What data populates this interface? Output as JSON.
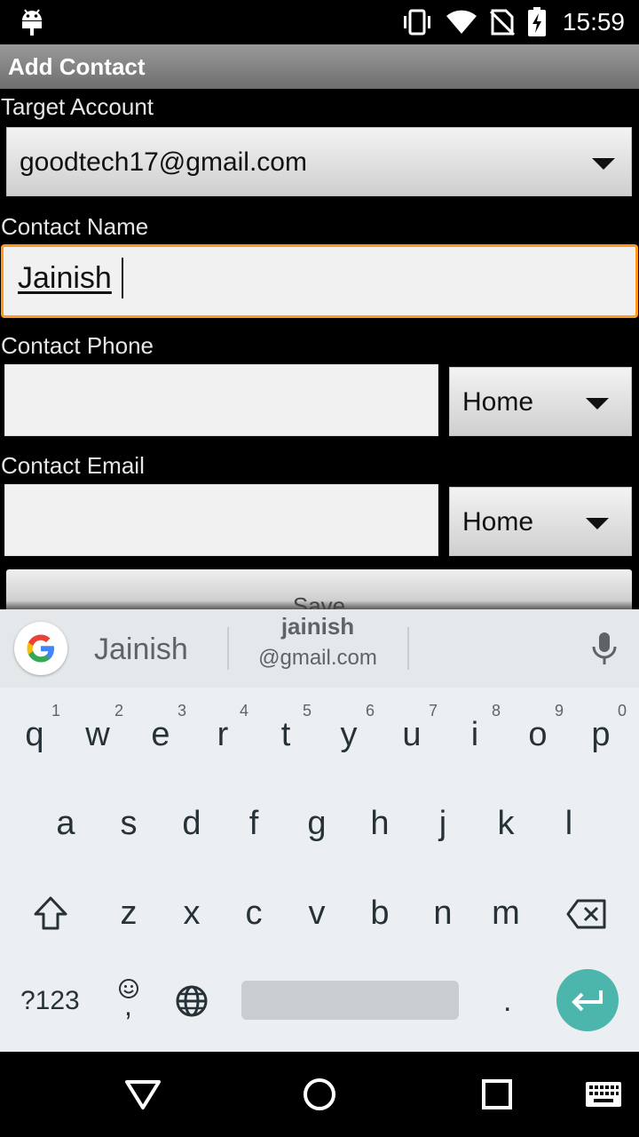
{
  "status_bar": {
    "time": "15:59",
    "icons": [
      "android-icon",
      "vibrate-icon",
      "wifi-icon",
      "no-sim-icon",
      "battery-charging-icon"
    ]
  },
  "app": {
    "title": "Add Contact"
  },
  "form": {
    "target_account_label": "Target Account",
    "target_account_value": "goodtech17@gmail.com",
    "contact_name_label": "Contact Name",
    "contact_name_value": "Jainish",
    "contact_phone_label": "Contact Phone",
    "contact_phone_value": "",
    "phone_type": "Home",
    "contact_email_label": "Contact Email",
    "contact_email_value": "",
    "email_type": "Home",
    "save_label": "Save"
  },
  "keyboard": {
    "suggestions": {
      "first": "Jainish",
      "second_line1": "jainish",
      "second_line2": "@gmail.com"
    },
    "row1": [
      {
        "ch": "q",
        "hint": "1"
      },
      {
        "ch": "w",
        "hint": "2"
      },
      {
        "ch": "e",
        "hint": "3"
      },
      {
        "ch": "r",
        "hint": "4"
      },
      {
        "ch": "t",
        "hint": "5"
      },
      {
        "ch": "y",
        "hint": "6"
      },
      {
        "ch": "u",
        "hint": "7"
      },
      {
        "ch": "i",
        "hint": "8"
      },
      {
        "ch": "o",
        "hint": "9"
      },
      {
        "ch": "p",
        "hint": "0"
      }
    ],
    "row2": [
      "a",
      "s",
      "d",
      "f",
      "g",
      "h",
      "j",
      "k",
      "l"
    ],
    "row3": [
      "z",
      "x",
      "c",
      "v",
      "b",
      "n",
      "m"
    ],
    "symbols_label": "?123",
    "comma_label": ",",
    "period_label": "."
  },
  "colors": {
    "focus_border": "#ff9a1a",
    "enter_key": "#4db6ac",
    "keyboard_bg": "#eceff1"
  }
}
